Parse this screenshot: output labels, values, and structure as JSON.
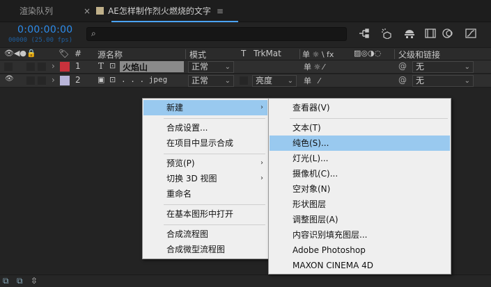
{
  "tabs": {
    "render_queue": "渲染队列",
    "close": "×",
    "comp_name": "AE怎样制作烈火燃烧的文字",
    "menu_glyph": "≡"
  },
  "timecode": {
    "time": "0:00:00:00",
    "fps": "00000 (25.00 fps)"
  },
  "search": {
    "icon": "⌕",
    "placeholder": ""
  },
  "toolbar_icons": [
    "comp-flowchart-icon",
    "draft-3d-icon",
    "shy-icon",
    "frame-blend-icon",
    "motion-blur-icon",
    "graph-editor-icon"
  ],
  "columns": {
    "num": "#",
    "source_name": "源名称",
    "mode": "模式",
    "t": "T",
    "trkmat": "TrkMat",
    "switches": "单 ☼ \\ fx",
    "parent": "父级和链接"
  },
  "layers": [
    {
      "num": "1",
      "type": "T",
      "name": "火焰山",
      "label_color": "#c8323c",
      "mode": "正常",
      "trkmat": "",
      "parent": "无"
    },
    {
      "num": "2",
      "type": "img",
      "name": ". . . jpeg",
      "label_color": "#b8b4d8",
      "mode": "正常",
      "trkmat": "亮度",
      "parent": "无"
    }
  ],
  "context_menu": {
    "items": [
      {
        "label": "新建",
        "submenu": true,
        "highlighted": true
      },
      {
        "label": "合成设置..."
      },
      {
        "label": "在项目中显示合成"
      },
      {
        "label": "预览(P)",
        "submenu": true
      },
      {
        "label": "切换 3D 视图",
        "submenu": true
      },
      {
        "label": "重命名"
      },
      {
        "label": "在基本图形中打开"
      },
      {
        "label": "合成流程图"
      },
      {
        "label": "合成微型流程图"
      }
    ]
  },
  "submenu_new": {
    "items": [
      {
        "label": "查看器(V)"
      },
      {
        "label": "文本(T)"
      },
      {
        "label": "纯色(S)...",
        "highlighted": true
      },
      {
        "label": "灯光(L)..."
      },
      {
        "label": "摄像机(C)..."
      },
      {
        "label": "空对象(N)"
      },
      {
        "label": "形状图层"
      },
      {
        "label": "调整图层(A)"
      },
      {
        "label": "内容识别填充图层..."
      },
      {
        "label": "Adobe Photoshop"
      },
      {
        "label": "MAXON CINEMA 4D"
      }
    ]
  },
  "submenu_arrow": "›",
  "dropdown_arrow": "⌄",
  "colors": {
    "accent": "#2d8ceb",
    "highlight": "#99c9ef",
    "menu_bg": "#efefef"
  }
}
